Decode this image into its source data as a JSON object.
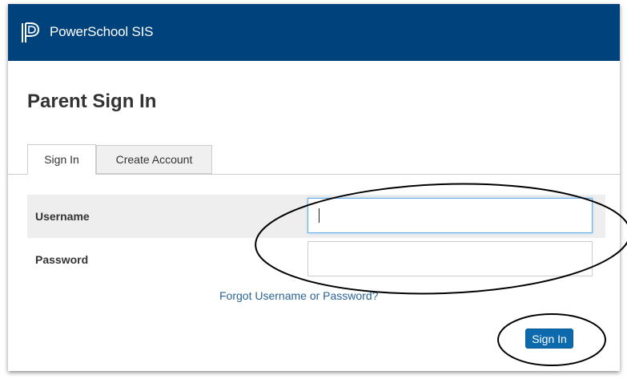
{
  "header": {
    "brand": "PowerSchool SIS",
    "background_color": "#00427c"
  },
  "page": {
    "title": "Parent Sign In"
  },
  "tabs": [
    {
      "label": "Sign In",
      "active": true
    },
    {
      "label": "Create Account",
      "active": false
    }
  ],
  "form": {
    "username_label": "Username",
    "username_value": "",
    "password_label": "Password",
    "password_value": "",
    "forgot_link": "Forgot Username or Password?",
    "submit_label": "Sign In",
    "accent_color": "#0d6aad"
  }
}
